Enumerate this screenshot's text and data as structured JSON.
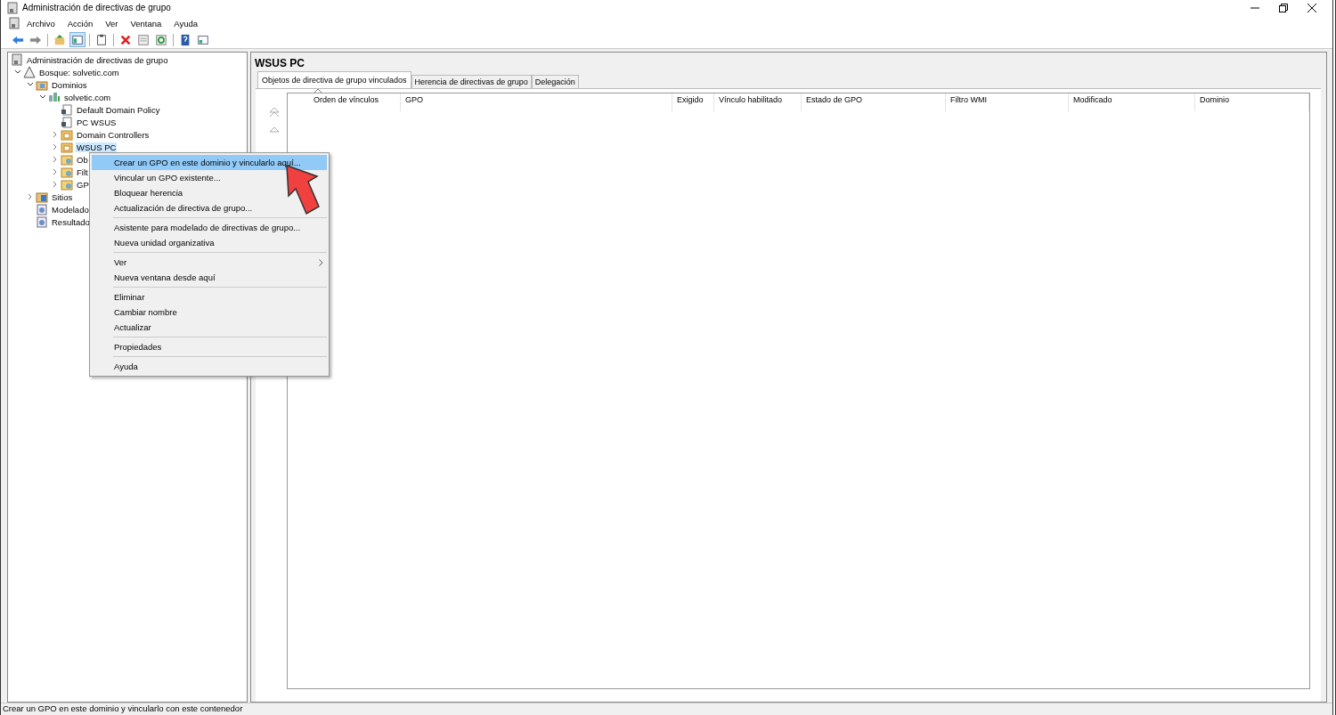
{
  "window": {
    "title": "Administración de directivas de grupo"
  },
  "menu_bar": [
    "Archivo",
    "Acción",
    "Ver",
    "Ventana",
    "Ayuda"
  ],
  "toolbar": [
    {
      "pressed": false
    },
    {
      "pressed": false
    },
    {
      "pressed": false
    },
    {
      "pressed": true
    },
    {
      "pressed": false
    },
    {
      "pressed": false
    },
    {
      "pressed": false
    },
    {
      "pressed": false
    },
    {
      "pressed": false
    },
    {
      "pressed": false
    }
  ],
  "tree": [
    {
      "label": "Administración de directivas de grupo",
      "kind": "console",
      "selected": false,
      "children": [
        {
          "label": "Bosque: solvetic.com",
          "kind": "forest",
          "expanded": true,
          "selected": false,
          "children": [
            {
              "label": "Dominios",
              "kind": "domains",
              "expanded": true,
              "selected": false,
              "children": [
                {
                  "label": "solvetic.com",
                  "kind": "domain",
                  "expanded": true,
                  "selected": false,
                  "children": [
                    {
                      "label": "Default Domain Policy",
                      "kind": "gpo",
                      "selected": false
                    },
                    {
                      "label": "PC WSUS",
                      "kind": "gpo",
                      "selected": false
                    },
                    {
                      "label": "Domain Controllers",
                      "kind": "ou",
                      "expanded": false,
                      "selected": false
                    },
                    {
                      "label": "WSUS PC",
                      "kind": "ou",
                      "expanded": false,
                      "selected": true
                    },
                    {
                      "label": "Ob",
                      "kind": "folder",
                      "expanded": false,
                      "selected": false
                    },
                    {
                      "label": "Filt",
                      "kind": "folder",
                      "expanded": false,
                      "selected": false
                    },
                    {
                      "label": "GP",
                      "kind": "folder",
                      "expanded": false,
                      "selected": false
                    }
                  ]
                }
              ]
            },
            {
              "label": "Sitios",
              "kind": "sites",
              "expanded": false,
              "selected": false
            },
            {
              "label": "Modelado",
              "kind": "modeling",
              "selected": false
            },
            {
              "label": "Resultado",
              "kind": "modeling",
              "selected": false
            }
          ]
        }
      ]
    }
  ],
  "detail": {
    "title": "WSUS PC",
    "tabs": [
      {
        "label": "Objetos de directiva de grupo vinculados",
        "selected": true
      },
      {
        "label": "Herencia de directivas de grupo",
        "selected": false
      },
      {
        "label": "Delegación",
        "selected": false
      }
    ],
    "columns": [
      "Orden de vínculos",
      "GPO",
      "Exigido",
      "Vínculo habilitado",
      "Estado de GPO",
      "Filtro WMI",
      "Modificado",
      "Dominio"
    ]
  },
  "context_menu": {
    "groups": [
      [
        {
          "label": "Crear un GPO en este dominio y vincularlo aquí...",
          "selected": true,
          "has_submenu": false
        },
        {
          "label": "Vincular un GPO existente...",
          "selected": false,
          "has_submenu": false
        },
        {
          "label": "Bloquear herencia",
          "selected": false,
          "has_submenu": false
        },
        {
          "label": "Actualización de directiva de grupo...",
          "selected": false,
          "has_submenu": false
        }
      ],
      [
        {
          "label": "Asistente para modelado de directivas de grupo...",
          "selected": false,
          "has_submenu": false
        },
        {
          "label": "Nueva unidad organizativa",
          "selected": false,
          "has_submenu": false
        }
      ],
      [
        {
          "label": "Ver",
          "selected": false,
          "has_submenu": true
        },
        {
          "label": "Nueva ventana desde aquí",
          "selected": false,
          "has_submenu": false
        }
      ],
      [
        {
          "label": "Eliminar",
          "selected": false,
          "has_submenu": false
        },
        {
          "label": "Cambiar nombre",
          "selected": false,
          "has_submenu": false
        },
        {
          "label": "Actualizar",
          "selected": false,
          "has_submenu": false
        }
      ],
      [
        {
          "label": "Propiedades",
          "selected": false,
          "has_submenu": false
        }
      ],
      [
        {
          "label": "Ayuda",
          "selected": false,
          "has_submenu": false
        }
      ]
    ]
  },
  "status_bar": "Crear un GPO en este dominio y vincularlo con este contenedor"
}
